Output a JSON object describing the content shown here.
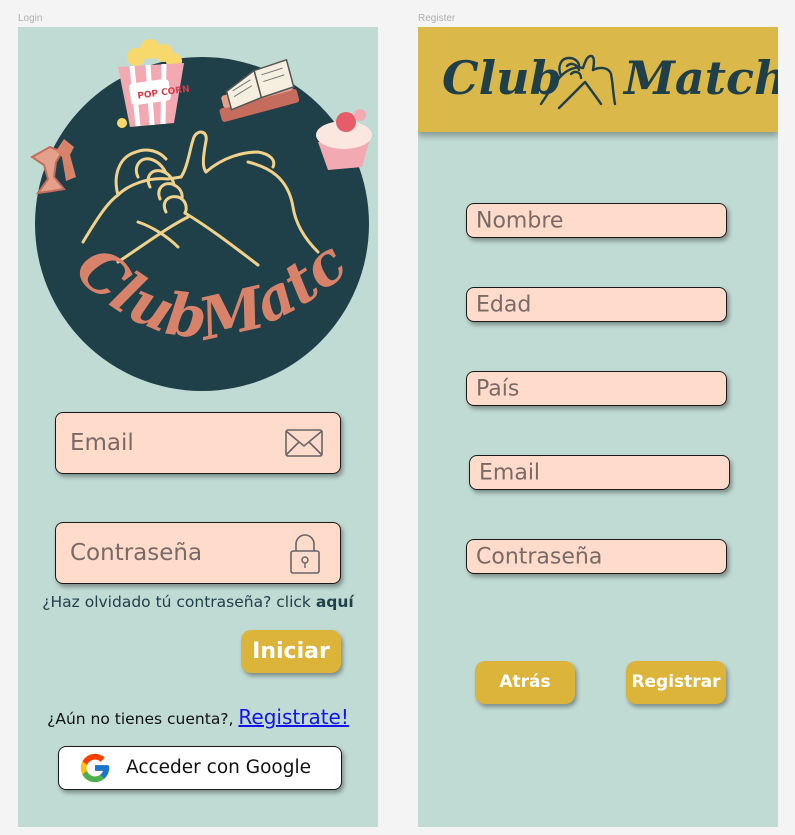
{
  "frames": {
    "login_label": "Login",
    "register_label": "Register"
  },
  "login": {
    "logo_text": "ClubMatch",
    "popcorn_text": "POP CORN",
    "email_placeholder": "Email",
    "password_placeholder": "Contraseña",
    "forgot_text": "¿Haz olvidado tú contraseña? click ",
    "forgot_link": "aquí",
    "login_button": "Iniciar",
    "no_account_text": "¿Aún no tienes cuenta?, ",
    "register_link": "Registrate!",
    "google_button": "Acceder con Google"
  },
  "register": {
    "title_left": "Club",
    "title_right": "Match",
    "fields": [
      "Nombre",
      "Edad",
      "País",
      "Email",
      "Contraseña"
    ],
    "back_button": "Atrás",
    "register_button": "Registrar"
  },
  "colors": {
    "frame_bg": "#c0dad4",
    "field_bg": "#ffdbcc",
    "button_bg": "#dcb43a",
    "header_bg": "#dbb84a",
    "circle_bg": "#1f3f49",
    "logo_text": "#d8826a"
  },
  "icons": [
    "mail-icon",
    "lock-icon",
    "google-icon",
    "pinky-promise-icon",
    "popcorn-icon",
    "book-icon",
    "cupcake-icon"
  ]
}
